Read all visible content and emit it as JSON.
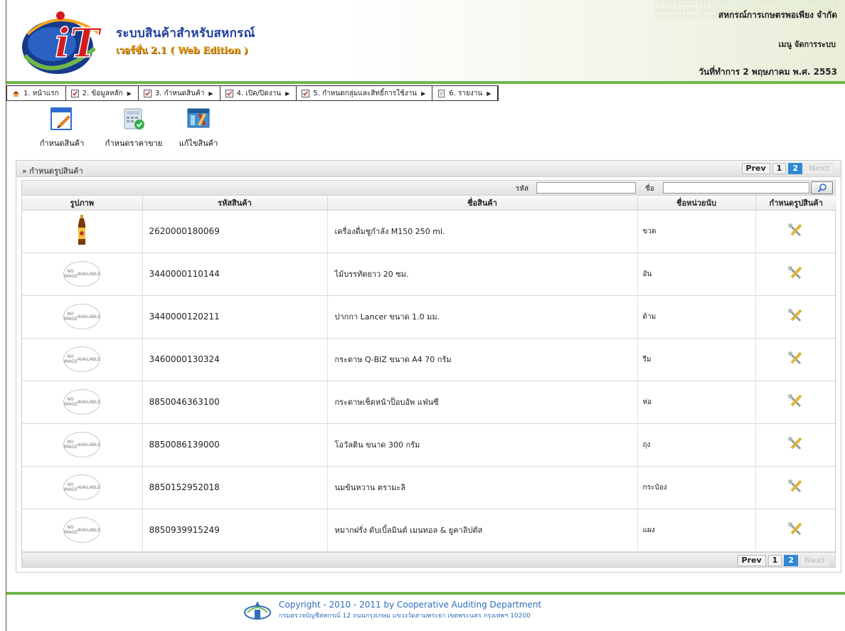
{
  "header": {
    "app_title": "ระบบสินค้าสำหรับสหกรณ์",
    "app_version": "เวอร์ชั่น 2.1 ( Web Edition )",
    "logo_text": "iT",
    "org_name": "สหกรณ์การเกษตรพอเพียง จำกัด",
    "user_name": "เมนู จัดการระบบ",
    "work_date": "วันที่ทำการ 2 พฤษภาคม พ.ศ. 2553",
    "binary_bg": "1010001010100101001010101000101101110001011100001110010001000110011000111011100001000111010010001010001000100011000111"
  },
  "menu": [
    {
      "label": "1. หน้าแรก",
      "icon": "home-icon",
      "arrow": false
    },
    {
      "label": "2. ข้อมูลหลัก",
      "icon": "checklist-icon",
      "arrow": true
    },
    {
      "label": "3. กำหนดสินค้า",
      "icon": "checklist-icon",
      "arrow": true
    },
    {
      "label": "4. เปิด/ปิดงาน",
      "icon": "checklist-icon",
      "arrow": true
    },
    {
      "label": "5. กำหนดกลุ่มและสิทธิ์การใช้งาน",
      "icon": "checklist-icon",
      "arrow": true
    },
    {
      "label": "6. รายงาน",
      "icon": "document-icon",
      "arrow": true
    }
  ],
  "toolbar": [
    {
      "label": "กำหนดสินค้า",
      "icon": "define-product-icon"
    },
    {
      "label": "กำหนดราคาขาย",
      "icon": "price-calculator-icon"
    },
    {
      "label": "แก้ไขสินค้า",
      "icon": "edit-product-tools-icon"
    }
  ],
  "panel": {
    "title": "» กำหนดรูปสินค้า",
    "pager": {
      "prev": "Prev",
      "pages": [
        "1",
        "2"
      ],
      "current": "2",
      "next": "Next"
    }
  },
  "search": {
    "code_label": "รหัส",
    "code_value": "",
    "name_label": "ชื่อ",
    "name_value": ""
  },
  "table": {
    "columns": [
      "รูปภาพ",
      "รหัสสินค้า",
      "ชื่อสินค้า",
      "ชื่อหน่วยนับ",
      "กำหนดรูปสินค้า"
    ],
    "no_image_text": [
      "NO IMAGE",
      "AVAILABLE"
    ],
    "rows": [
      {
        "image": "product-photo",
        "code": "2620000180069",
        "name": "เครื่องดื่มชูกำลัง M150 250 ml.",
        "unit": "ขวด"
      },
      {
        "image": "no-image",
        "code": "3440000110144",
        "name": "ไม้บรรทัดยาว 20 ซม.",
        "unit": "อัน"
      },
      {
        "image": "no-image",
        "code": "3440000120211",
        "name": "ปากกา Lancer ขนาด 1.0 มม.",
        "unit": "ด้าม"
      },
      {
        "image": "no-image",
        "code": "3460000130324",
        "name": "กระดาษ Q-BIZ ขนาด A4 70 กรัม",
        "unit": "รีม"
      },
      {
        "image": "no-image",
        "code": "8850046363100",
        "name": "กระดาษเช็ดหน้าป็อบอัพ แฟ่นซี",
        "unit": "ห่อ"
      },
      {
        "image": "no-image",
        "code": "8850086139000",
        "name": "โอวัลติน ขนาด 300 กรัม",
        "unit": "ถุง"
      },
      {
        "image": "no-image",
        "code": "8850152952018",
        "name": "นมข้นหวาน ตรามะลิ",
        "unit": "กระป๋อง"
      },
      {
        "image": "no-image",
        "code": "8850939915249",
        "name": "หมากฝรั่ง ดับเบิ้ลมินต์ เมนทอล & ยูคาลิปตัส",
        "unit": "แผง"
      }
    ]
  },
  "footer": {
    "copyright": "Copyright - 2010 - 2011  by Cooperative Auditing Department",
    "address": "กรมตรวจบัญชีสหกรณ์ 12 ถนนกรุงเกษม แขวงวัดสามพระยา เขตพระนคร กรุงเทพฯ 10200"
  },
  "colors": {
    "accent_green": "#6fb74a",
    "title_blue": "#1f3d99",
    "version_orange": "#f2a41c",
    "pager_active": "#2f88d6"
  }
}
